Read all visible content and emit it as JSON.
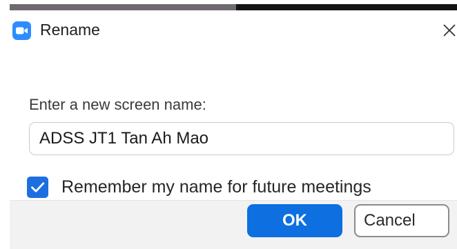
{
  "dialog": {
    "title": "Rename",
    "app_icon": "zoom-camera-icon",
    "close_icon": "close-icon"
  },
  "form": {
    "prompt_label": "Enter a new screen name:",
    "name_value": "ADSS JT1 Tan Ah Mao",
    "remember_checked": true,
    "remember_label": "Remember my name for future meetings"
  },
  "footer": {
    "ok_label": "OK",
    "cancel_label": "Cancel"
  },
  "colors": {
    "accent": "#0e6fe0",
    "app_icon_bg": "#2d8cff",
    "footer_bg": "#f2f2f2"
  }
}
